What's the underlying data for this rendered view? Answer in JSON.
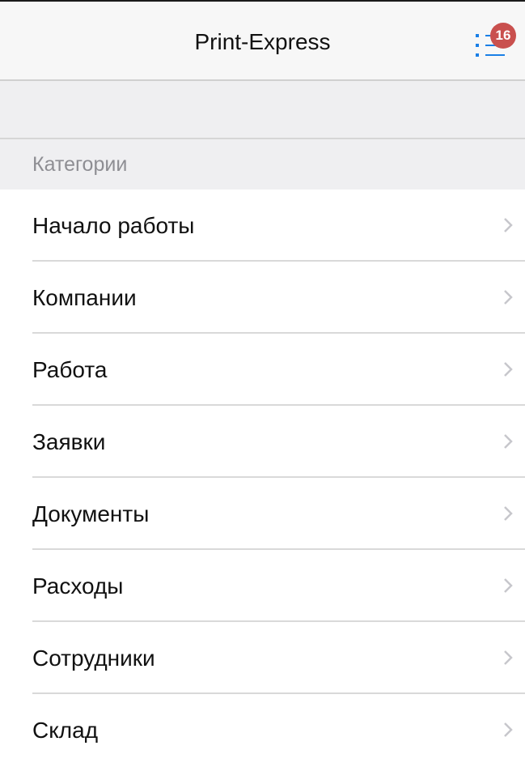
{
  "header": {
    "title": "Print-Express",
    "menu_icon": "list-menu-icon",
    "badge_count": "16",
    "accent_color": "#1a7fe6",
    "badge_color": "#c9504e"
  },
  "section": {
    "label": "Категории"
  },
  "categories": [
    {
      "label": "Начало работы"
    },
    {
      "label": "Компании"
    },
    {
      "label": "Работа"
    },
    {
      "label": "Заявки"
    },
    {
      "label": "Документы"
    },
    {
      "label": "Расходы"
    },
    {
      "label": "Сотрудники"
    },
    {
      "label": "Склад"
    }
  ],
  "row_icon": "chevron-right-icon"
}
